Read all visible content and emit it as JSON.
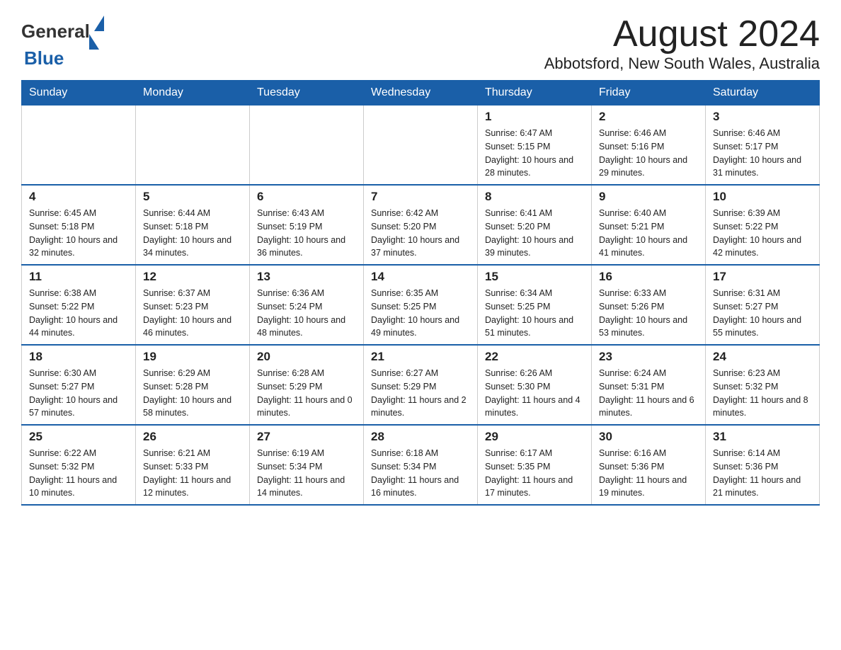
{
  "header": {
    "logo_general": "General",
    "logo_blue": "Blue",
    "month_title": "August 2024",
    "location": "Abbotsford, New South Wales, Australia"
  },
  "days_of_week": [
    "Sunday",
    "Monday",
    "Tuesday",
    "Wednesday",
    "Thursday",
    "Friday",
    "Saturday"
  ],
  "weeks": [
    [
      {
        "day": "",
        "info": ""
      },
      {
        "day": "",
        "info": ""
      },
      {
        "day": "",
        "info": ""
      },
      {
        "day": "",
        "info": ""
      },
      {
        "day": "1",
        "info": "Sunrise: 6:47 AM\nSunset: 5:15 PM\nDaylight: 10 hours and 28 minutes."
      },
      {
        "day": "2",
        "info": "Sunrise: 6:46 AM\nSunset: 5:16 PM\nDaylight: 10 hours and 29 minutes."
      },
      {
        "day": "3",
        "info": "Sunrise: 6:46 AM\nSunset: 5:17 PM\nDaylight: 10 hours and 31 minutes."
      }
    ],
    [
      {
        "day": "4",
        "info": "Sunrise: 6:45 AM\nSunset: 5:18 PM\nDaylight: 10 hours and 32 minutes."
      },
      {
        "day": "5",
        "info": "Sunrise: 6:44 AM\nSunset: 5:18 PM\nDaylight: 10 hours and 34 minutes."
      },
      {
        "day": "6",
        "info": "Sunrise: 6:43 AM\nSunset: 5:19 PM\nDaylight: 10 hours and 36 minutes."
      },
      {
        "day": "7",
        "info": "Sunrise: 6:42 AM\nSunset: 5:20 PM\nDaylight: 10 hours and 37 minutes."
      },
      {
        "day": "8",
        "info": "Sunrise: 6:41 AM\nSunset: 5:20 PM\nDaylight: 10 hours and 39 minutes."
      },
      {
        "day": "9",
        "info": "Sunrise: 6:40 AM\nSunset: 5:21 PM\nDaylight: 10 hours and 41 minutes."
      },
      {
        "day": "10",
        "info": "Sunrise: 6:39 AM\nSunset: 5:22 PM\nDaylight: 10 hours and 42 minutes."
      }
    ],
    [
      {
        "day": "11",
        "info": "Sunrise: 6:38 AM\nSunset: 5:22 PM\nDaylight: 10 hours and 44 minutes."
      },
      {
        "day": "12",
        "info": "Sunrise: 6:37 AM\nSunset: 5:23 PM\nDaylight: 10 hours and 46 minutes."
      },
      {
        "day": "13",
        "info": "Sunrise: 6:36 AM\nSunset: 5:24 PM\nDaylight: 10 hours and 48 minutes."
      },
      {
        "day": "14",
        "info": "Sunrise: 6:35 AM\nSunset: 5:25 PM\nDaylight: 10 hours and 49 minutes."
      },
      {
        "day": "15",
        "info": "Sunrise: 6:34 AM\nSunset: 5:25 PM\nDaylight: 10 hours and 51 minutes."
      },
      {
        "day": "16",
        "info": "Sunrise: 6:33 AM\nSunset: 5:26 PM\nDaylight: 10 hours and 53 minutes."
      },
      {
        "day": "17",
        "info": "Sunrise: 6:31 AM\nSunset: 5:27 PM\nDaylight: 10 hours and 55 minutes."
      }
    ],
    [
      {
        "day": "18",
        "info": "Sunrise: 6:30 AM\nSunset: 5:27 PM\nDaylight: 10 hours and 57 minutes."
      },
      {
        "day": "19",
        "info": "Sunrise: 6:29 AM\nSunset: 5:28 PM\nDaylight: 10 hours and 58 minutes."
      },
      {
        "day": "20",
        "info": "Sunrise: 6:28 AM\nSunset: 5:29 PM\nDaylight: 11 hours and 0 minutes."
      },
      {
        "day": "21",
        "info": "Sunrise: 6:27 AM\nSunset: 5:29 PM\nDaylight: 11 hours and 2 minutes."
      },
      {
        "day": "22",
        "info": "Sunrise: 6:26 AM\nSunset: 5:30 PM\nDaylight: 11 hours and 4 minutes."
      },
      {
        "day": "23",
        "info": "Sunrise: 6:24 AM\nSunset: 5:31 PM\nDaylight: 11 hours and 6 minutes."
      },
      {
        "day": "24",
        "info": "Sunrise: 6:23 AM\nSunset: 5:32 PM\nDaylight: 11 hours and 8 minutes."
      }
    ],
    [
      {
        "day": "25",
        "info": "Sunrise: 6:22 AM\nSunset: 5:32 PM\nDaylight: 11 hours and 10 minutes."
      },
      {
        "day": "26",
        "info": "Sunrise: 6:21 AM\nSunset: 5:33 PM\nDaylight: 11 hours and 12 minutes."
      },
      {
        "day": "27",
        "info": "Sunrise: 6:19 AM\nSunset: 5:34 PM\nDaylight: 11 hours and 14 minutes."
      },
      {
        "day": "28",
        "info": "Sunrise: 6:18 AM\nSunset: 5:34 PM\nDaylight: 11 hours and 16 minutes."
      },
      {
        "day": "29",
        "info": "Sunrise: 6:17 AM\nSunset: 5:35 PM\nDaylight: 11 hours and 17 minutes."
      },
      {
        "day": "30",
        "info": "Sunrise: 6:16 AM\nSunset: 5:36 PM\nDaylight: 11 hours and 19 minutes."
      },
      {
        "day": "31",
        "info": "Sunrise: 6:14 AM\nSunset: 5:36 PM\nDaylight: 11 hours and 21 minutes."
      }
    ]
  ]
}
